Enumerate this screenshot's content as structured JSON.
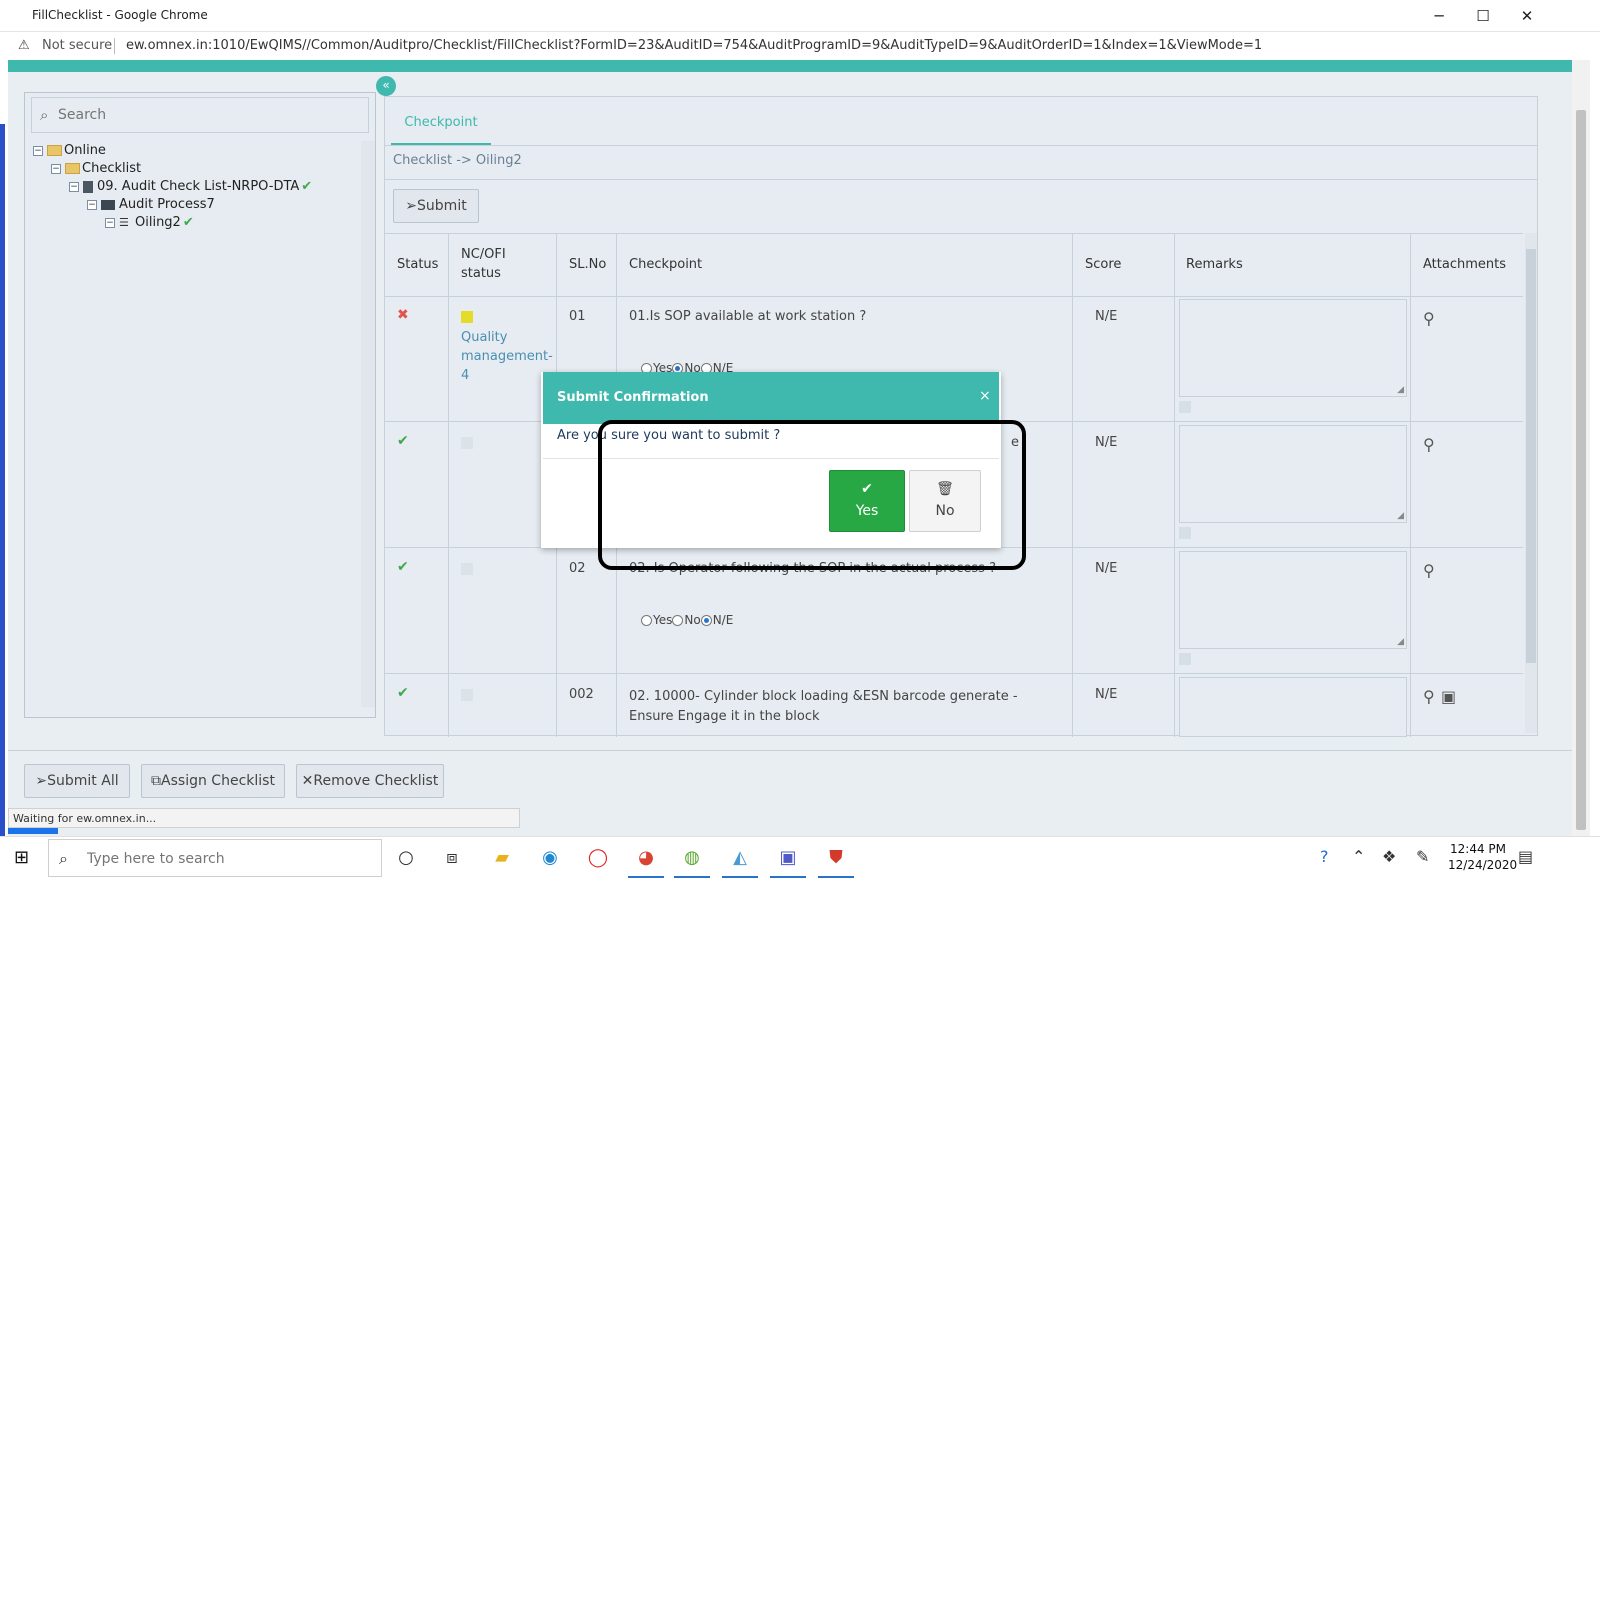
{
  "window": {
    "title": "FillChecklist - Google Chrome",
    "minimize": "─",
    "maximize": "☐",
    "close": "✕"
  },
  "address": {
    "security_icon": "⚠",
    "security_label": "Not secure",
    "url": "ew.omnex.in:1010/EwQIMS//Common/Auditpro/Checklist/FillChecklist?FormID=23&AuditID=754&AuditProgramID=9&AuditTypeID=9&AuditOrderID=1&Index=1&ViewMode=1"
  },
  "tree": {
    "search_placeholder": "Search",
    "items": [
      {
        "label": "Online",
        "level": 0,
        "kind": "folder",
        "checked": false
      },
      {
        "label": "Checklist",
        "level": 1,
        "kind": "folder",
        "checked": false
      },
      {
        "label": "09. Audit Check List-NRPO-DTA",
        "level": 2,
        "kind": "doc",
        "checked": true
      },
      {
        "label": "Audit Process7",
        "level": 3,
        "kind": "book",
        "checked": false
      },
      {
        "label": "Oiling2",
        "level": 4,
        "kind": "list",
        "checked": true
      }
    ],
    "check_mark": "✔",
    "collapse": "«"
  },
  "main": {
    "tab": "Checkpoint",
    "breadcrumb": "Checklist -> Oiling2",
    "submit_label": "Submit",
    "columns": {
      "status": "Status",
      "nc_ofi": "NC/OFI status",
      "sl_no": "SL.No",
      "checkpoint": "Checkpoint",
      "score": "Score",
      "remarks": "Remarks",
      "attachments": "Attachments"
    },
    "rows": [
      {
        "status": "✖",
        "nc_label": "Quality management-4",
        "sl_no": "01",
        "checkpoint": "01.Is SOP available at work station ?",
        "score": "N/E",
        "radio_yes": "Yes",
        "radio_no": "No",
        "radio_ne": "N/E"
      },
      {
        "status": "✔",
        "nc_label": "",
        "sl_no": "",
        "checkpoint": "e",
        "score": "N/E"
      },
      {
        "status": "✔",
        "nc_label": "",
        "sl_no": "02",
        "checkpoint": "02. Is Operator following the SOP in the actual process ?",
        "score": "N/E",
        "radio_yes": "Yes",
        "radio_no": "No",
        "radio_ne": "N/E"
      },
      {
        "status": "✔",
        "nc_label": "",
        "sl_no": "002",
        "checkpoint": "02. 10000- Cylinder block loading &ESN barcode generate - Ensure Engage it in the block",
        "score": "N/E"
      }
    ]
  },
  "bottom": {
    "submit_all": "Submit All",
    "assign": "Assign Checklist",
    "remove": "Remove Checklist",
    "status": "Waiting for ew.omnex.in..."
  },
  "modal": {
    "title": "Submit Confirmation",
    "close": "×",
    "message": "Are you sure you want to submit ?",
    "yes": "Yes",
    "no": "No"
  },
  "taskbar": {
    "search_placeholder": "Type here to search",
    "time": "12:44 PM",
    "date": "12/24/2020"
  },
  "colors": {
    "accent": "#3fb8ad",
    "yes_button": "#27a844",
    "nc_yellow": "#e5dc2a",
    "status_red": "#e0544f",
    "status_green": "#3ea84a"
  }
}
